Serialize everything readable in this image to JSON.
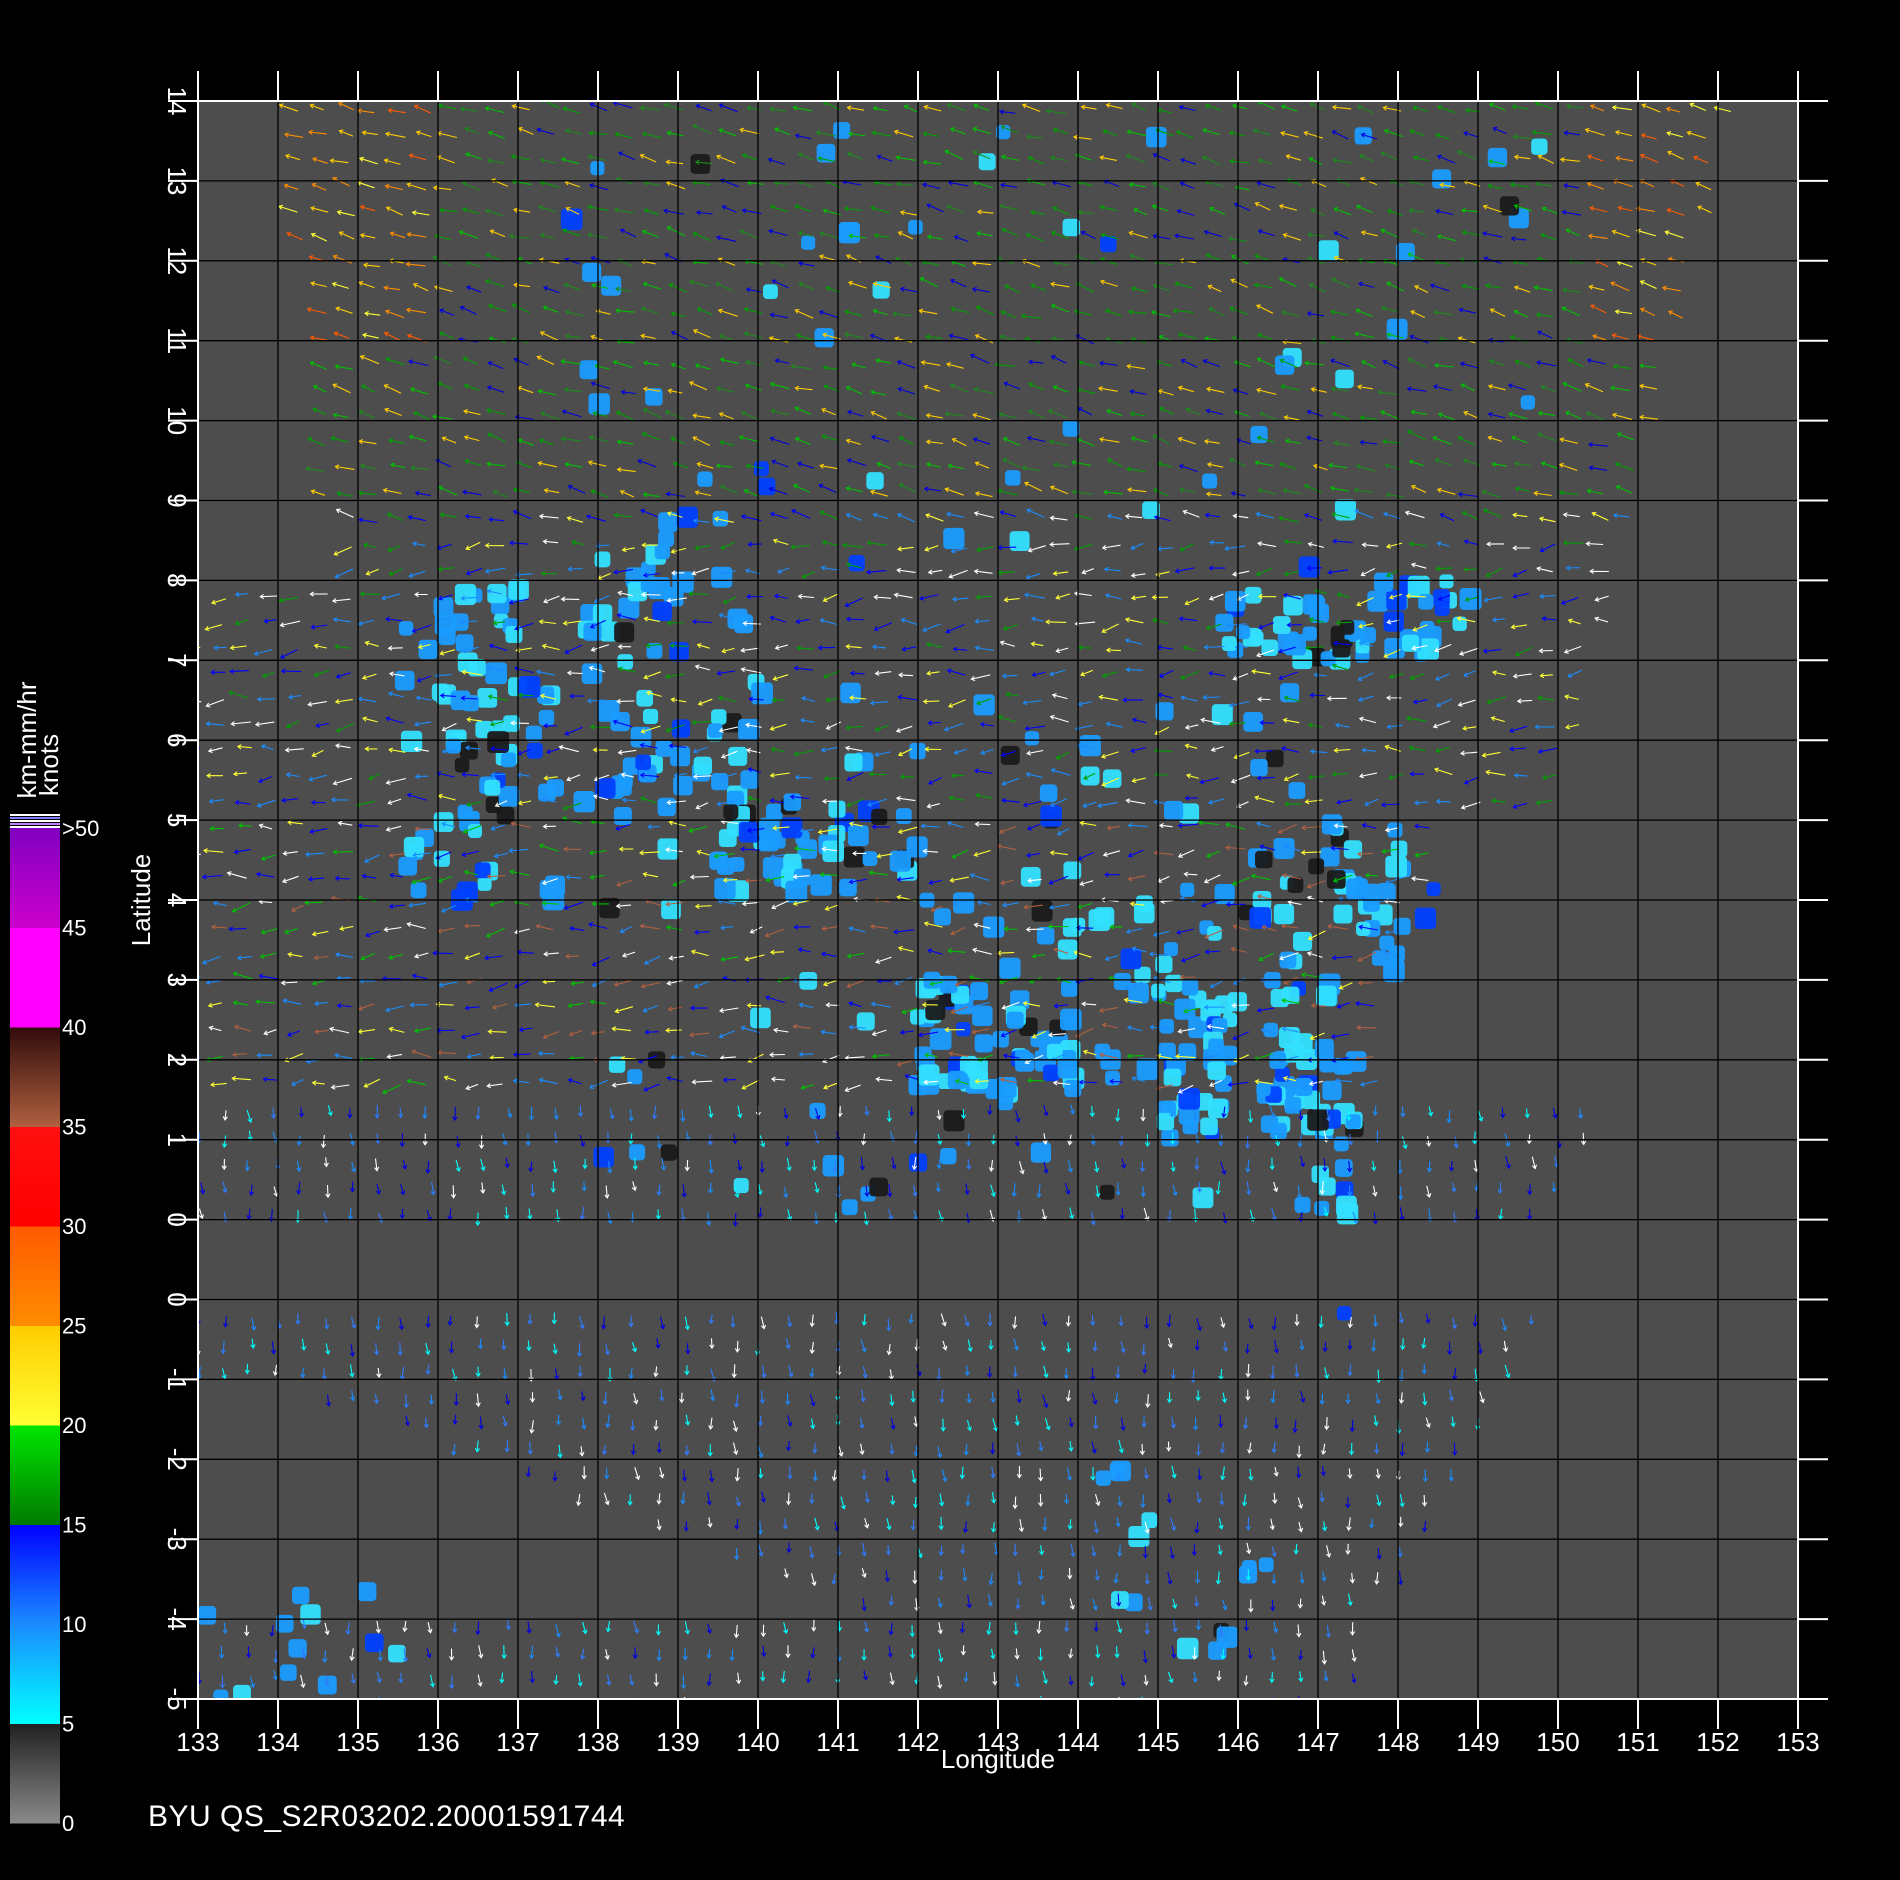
{
  "chart_data": {
    "type": "vector-field",
    "xlabel": "Longitude",
    "ylabel": "Latitude",
    "xlim": [
      133,
      153
    ],
    "ylim": [
      -5,
      14
    ],
    "x_ticks": [
      "133",
      "134",
      "135",
      "136",
      "137",
      "138",
      "139",
      "140",
      "141",
      "142",
      "143",
      "144",
      "145",
      "146",
      "147",
      "148",
      "149",
      "150",
      "151",
      "152",
      "153"
    ],
    "y_ticks": [
      "-5",
      "-4",
      "-3",
      "-2",
      "-1",
      "0",
      "0",
      "1",
      "2",
      "3",
      "4",
      "5",
      "6",
      "7",
      "8",
      "9",
      "10",
      "11",
      "12",
      "13",
      "14"
    ],
    "grid": true,
    "colorbar": {
      "unit_top": "km-mm/hr",
      "unit_bottom": "knots",
      "labels": [
        "0",
        "5",
        "10",
        "15",
        "20",
        "25",
        "30",
        "35",
        "40",
        "45",
        ">50"
      ],
      "bands": [
        {
          "from": 0,
          "to": 5,
          "start": "#8a8a8a",
          "end": "#202020"
        },
        {
          "from": 5,
          "to": 10,
          "start": "#00ffff",
          "end": "#1a8cff"
        },
        {
          "from": 10,
          "to": 15,
          "start": "#1a8cff",
          "end": "#0000ff"
        },
        {
          "from": 15,
          "to": 20,
          "start": "#007a00",
          "end": "#00e600"
        },
        {
          "from": 20,
          "to": 25,
          "start": "#ffff33",
          "end": "#ffcc00"
        },
        {
          "from": 25,
          "to": 30,
          "start": "#ff8c00",
          "end": "#ff5a00"
        },
        {
          "from": 30,
          "to": 35,
          "start": "#ff0000",
          "end": "#ff1010"
        },
        {
          "from": 35,
          "to": 40,
          "start": "#b06040",
          "end": "#300a0a"
        },
        {
          "from": 40,
          "to": 45,
          "start": "#ff00ff",
          "end": "#ff00ff"
        },
        {
          "from": 45,
          "to": 50,
          "start": "#cc00cc",
          "end": "#8000c0"
        }
      ]
    },
    "colors": {
      "background": "#000000",
      "plot_bg": "#4d4d4d",
      "grid": "#000000",
      "rain_cell": "#1a9cff",
      "rain_cell_bright": "#33e0ff"
    }
  },
  "footer": "BYU  QS_S2R03202.20001591744"
}
